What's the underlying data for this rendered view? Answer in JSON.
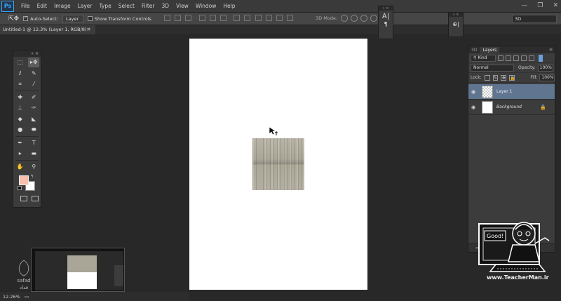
{
  "app": {
    "logo": "Ps"
  },
  "menu": [
    "File",
    "Edit",
    "Image",
    "Layer",
    "Type",
    "Select",
    "Filter",
    "3D",
    "View",
    "Window",
    "Help"
  ],
  "window_controls": [
    "—",
    "❐",
    "✕"
  ],
  "options_bar": {
    "auto_select_label": "Auto-Select:",
    "auto_select_value": "Layer",
    "show_transform_label": "Show Transform Controls",
    "mode_3d_label": "3D Mode:",
    "workspace": "3D"
  },
  "document_tab": {
    "title": "Untitled-1 @ 12.3% (Layer 1, RGB/8) *",
    "close": "×"
  },
  "toolbox": {
    "header": "«  ×",
    "colors": {
      "foreground": "#f6c0ad",
      "background": "#ffffff"
    }
  },
  "character_panel": {
    "header": "»  ×",
    "icon_label": "A|",
    "para_icon": "¶"
  },
  "panel_3d": {
    "header": "»  ×",
    "icon_label": "⊕|"
  },
  "layers_panel": {
    "tabs": [
      "3D",
      "Layers"
    ],
    "menu_icon": "≡",
    "filter_kind": "Kind",
    "blend_mode": "Normal",
    "opacity_label": "Opacity:",
    "opacity_value": "100%",
    "lock_label": "Lock:",
    "fill_label": "Fill:",
    "fill_value": "100%",
    "layers": [
      {
        "name": "Layer 1",
        "selected": true,
        "locked": false
      },
      {
        "name": "Background",
        "selected": false,
        "locked": true
      }
    ],
    "footer_icons": [
      "fx",
      "◐",
      "□",
      "▭",
      "🗑"
    ]
  },
  "status_bar": {
    "zoom": "12.26%"
  },
  "watermark_left": {
    "line1": "safad",
    "line2": "فداد"
  },
  "watermark_right": {
    "url": "www.TeacherMan.ir",
    "sign_text": "Good!"
  }
}
